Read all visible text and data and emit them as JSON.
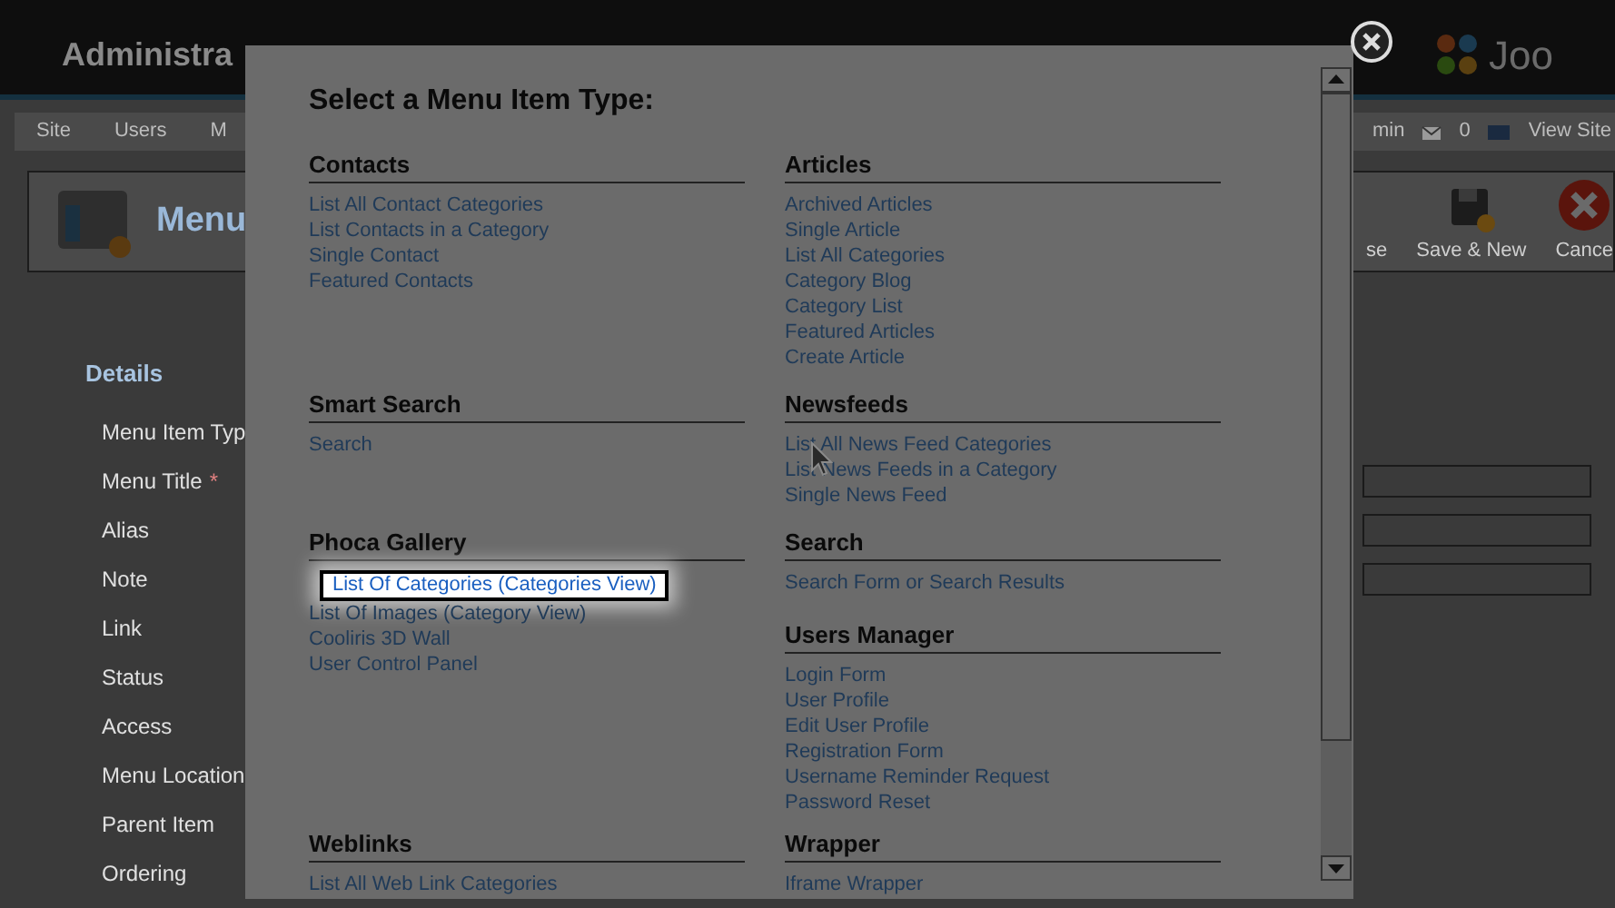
{
  "header": {
    "title": "Administra",
    "logo_text": "Joo"
  },
  "menubar": {
    "items": [
      "Site",
      "Users",
      "M"
    ],
    "user": "min",
    "messages": "0",
    "view_site": "View Site"
  },
  "toolbar": {
    "title": "Menu",
    "buttons": [
      {
        "kind": "cut",
        "label": "se"
      },
      {
        "kind": "save-new",
        "label": "Save & New"
      },
      {
        "kind": "cancel",
        "label": "Cance"
      }
    ]
  },
  "details": {
    "legend": "Details",
    "fields": [
      {
        "label": "Menu Item Typ",
        "input": false
      },
      {
        "label": "Menu Title",
        "required": "*",
        "input": true
      },
      {
        "label": "Alias",
        "input": true
      },
      {
        "label": "Note",
        "input": true
      },
      {
        "label": "Link",
        "input": false
      },
      {
        "label": "Status",
        "input": false
      },
      {
        "label": "Access",
        "input": false
      },
      {
        "label": "Menu Location",
        "input": false
      },
      {
        "label": "Parent Item",
        "input": false
      },
      {
        "label": "Ordering",
        "input": false
      }
    ]
  },
  "modal": {
    "title": "Select a Menu Item Type:",
    "rows": [
      {
        "cells": [
          [
            {
              "heading": "Contacts",
              "links": [
                {
                  "label": "List All Contact Categories",
                  "selected": false
                },
                {
                  "label": "List Contacts in a Category",
                  "selected": false
                },
                {
                  "label": "Single Contact",
                  "selected": false
                },
                {
                  "label": "Featured Contacts",
                  "selected": false
                }
              ]
            }
          ],
          [
            {
              "heading": "Articles",
              "links": [
                {
                  "label": "Archived Articles",
                  "selected": false
                },
                {
                  "label": "Single Article",
                  "selected": false
                },
                {
                  "label": "List All Categories",
                  "selected": false
                },
                {
                  "label": "Category Blog",
                  "selected": false
                },
                {
                  "label": "Category List",
                  "selected": false
                },
                {
                  "label": "Featured Articles",
                  "selected": false
                },
                {
                  "label": "Create Article",
                  "selected": false
                }
              ]
            }
          ]
        ]
      },
      {
        "cells": [
          [
            {
              "heading": "Smart Search",
              "links": [
                {
                  "label": "Search",
                  "selected": false
                }
              ]
            }
          ],
          [
            {
              "heading": "Newsfeeds",
              "links": [
                {
                  "label": "List All News Feed Categories",
                  "selected": false
                },
                {
                  "label": "List News Feeds in a Category",
                  "selected": false
                },
                {
                  "label": "Single News Feed",
                  "selected": false
                }
              ]
            }
          ]
        ]
      },
      {
        "cells": [
          [
            {
              "heading": "Phoca Gallery",
              "links": [
                {
                  "label": "List Of Categories (Categories View)",
                  "selected": true
                },
                {
                  "label": "List Of Images (Category View)",
                  "selected": false
                },
                {
                  "label": "Cooliris 3D Wall",
                  "selected": false
                },
                {
                  "label": "User Control Panel",
                  "selected": false
                }
              ]
            }
          ],
          [
            {
              "heading": "Search",
              "links": [
                {
                  "label": "Search Form or Search Results",
                  "selected": false
                }
              ]
            },
            {
              "heading": "Users Manager",
              "links": [
                {
                  "label": "Login Form",
                  "selected": false
                },
                {
                  "label": "User Profile",
                  "selected": false
                },
                {
                  "label": "Edit User Profile",
                  "selected": false
                },
                {
                  "label": "Registration Form",
                  "selected": false
                },
                {
                  "label": "Username Reminder Request",
                  "selected": false
                },
                {
                  "label": "Password Reset",
                  "selected": false
                }
              ]
            }
          ]
        ]
      },
      {
        "cells": [
          [
            {
              "heading": "Weblinks",
              "links": [
                {
                  "label": "List All Web Link Categories",
                  "selected": false
                }
              ]
            }
          ],
          [
            {
              "heading": "Wrapper",
              "links": [
                {
                  "label": "Iframe Wrapper",
                  "selected": false
                }
              ]
            }
          ]
        ]
      }
    ]
  }
}
